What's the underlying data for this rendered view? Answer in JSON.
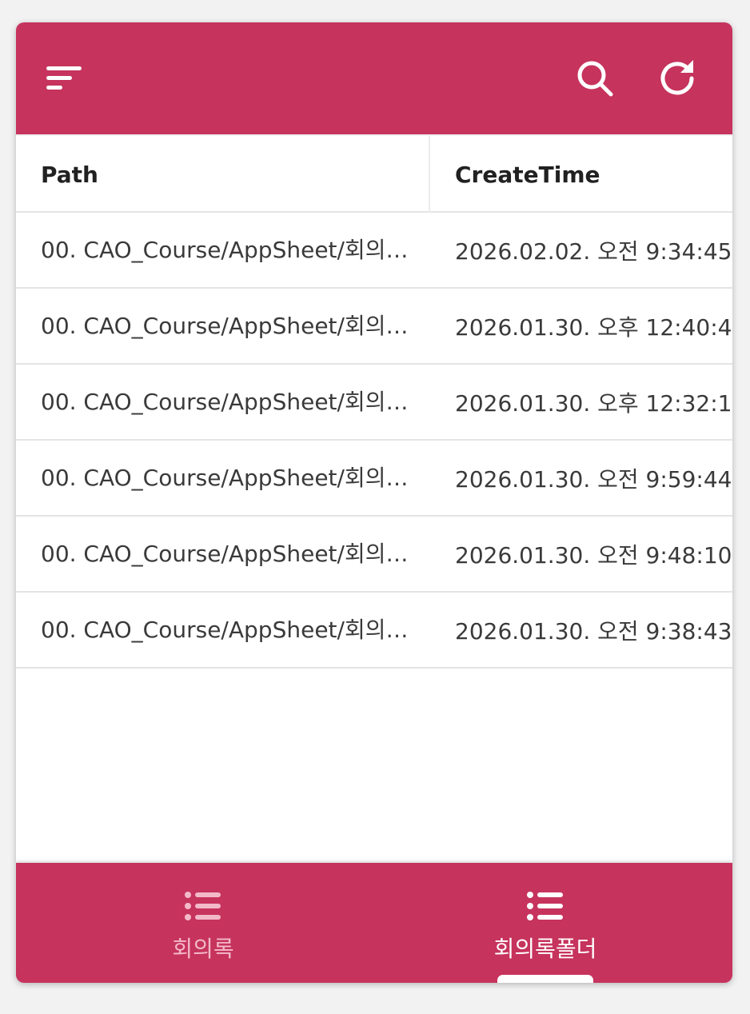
{
  "table": {
    "columns": [
      "Path",
      "CreateTime"
    ],
    "rows": [
      {
        "path": "00. CAO_Course/AppSheet/회의…",
        "create_time": "2026.02.02. 오전 9:34:45"
      },
      {
        "path": "00. CAO_Course/AppSheet/회의…",
        "create_time": "2026.01.30. 오후 12:40:4"
      },
      {
        "path": "00. CAO_Course/AppSheet/회의…",
        "create_time": "2026.01.30. 오후 12:32:1"
      },
      {
        "path": "00. CAO_Course/AppSheet/회의…",
        "create_time": "2026.01.30. 오전 9:59:44"
      },
      {
        "path": "00. CAO_Course/AppSheet/회의…",
        "create_time": "2026.01.30. 오전 9:48:10"
      },
      {
        "path": "00. CAO_Course/AppSheet/회의…",
        "create_time": "2026.01.30. 오전 9:38:43"
      }
    ]
  },
  "topbar": {
    "icons": [
      "sort-icon",
      "search-icon",
      "refresh-icon"
    ]
  },
  "bottom_nav": {
    "items": [
      {
        "label": "회의록",
        "icon": "list-icon",
        "active": false
      },
      {
        "label": "회의록폴더",
        "icon": "list-icon",
        "active": true
      }
    ]
  },
  "colors": {
    "accent": "#c6335d",
    "inactive_nav": "#f3b9c9"
  }
}
